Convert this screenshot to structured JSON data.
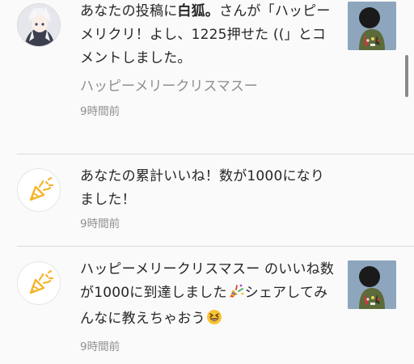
{
  "notifications": [
    {
      "text_prefix": "あなたの投稿に",
      "username": "白狐。",
      "text_suffix": "さんが「ハッピーメリクリ！よし、1225押せた ((」とコメントしました。",
      "quote": "ハッピーメリークリスマスー",
      "time": "9時間前"
    },
    {
      "text": "あなたの累計いいね！数が1000になりました！",
      "time": "9時間前"
    },
    {
      "text_prefix": "ハッピーメリークリスマスー のいいね数が1000に到達しました",
      "text_middle": "シェアしてみんなに教えちゃおう",
      "time": "9時間前"
    }
  ],
  "icons": {
    "party": "party-popper-icon",
    "laugh": "grinning-squinting-face-icon"
  },
  "colors": {
    "background": "#fafafa",
    "secondary_text": "#8e8e8e",
    "divider": "#dbdbdb",
    "party_yellow": "#f5b42a",
    "thumbnail_blue": "#8ea6bd"
  }
}
